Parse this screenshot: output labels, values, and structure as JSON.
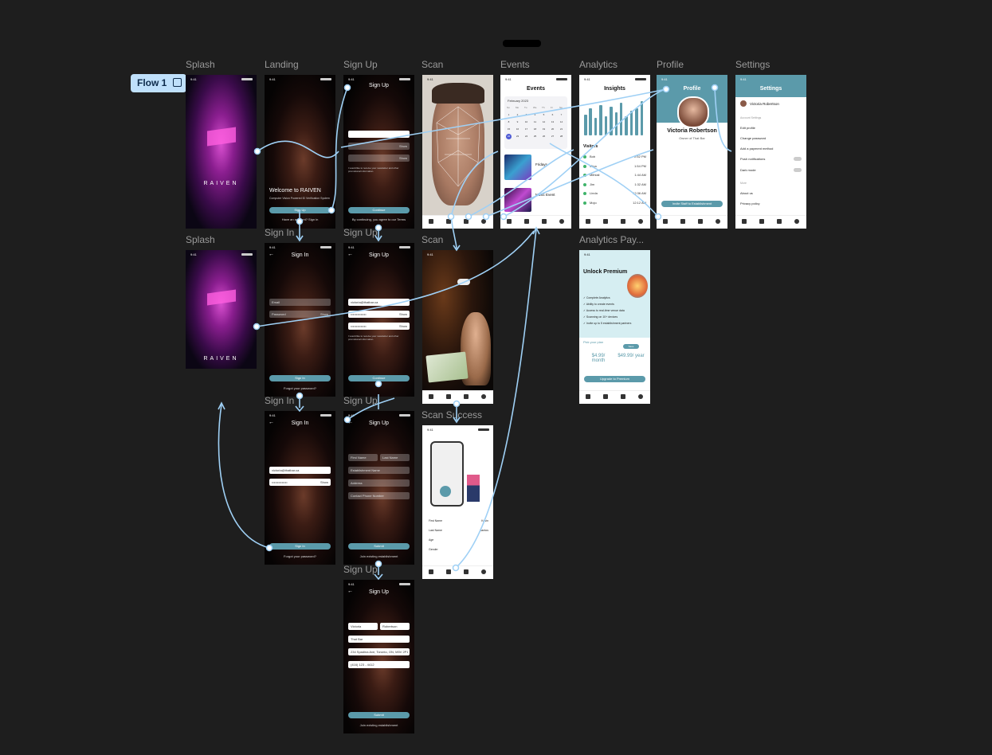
{
  "flow": {
    "label": "Flow 1"
  },
  "labels": {
    "splash1": "Splash",
    "landing": "Landing",
    "signup1": "Sign Up",
    "scan1": "Scan",
    "events": "Events",
    "analytics": "Analytics",
    "profile": "Profile",
    "settings": "Settings",
    "splash2": "Splash",
    "signin1": "Sign In",
    "signup2": "Sign Up",
    "scan2": "Scan",
    "analytics_pay": "Analytics Pay...",
    "signin2": "Sign In",
    "signup3": "Sign Up",
    "scan_success": "Scan Success",
    "signup4": "Sign Up"
  },
  "common": {
    "time": "9:41"
  },
  "splash": {
    "wordmark": "RAIVEN"
  },
  "landing": {
    "welcome": "Welcome to RAIVEN",
    "tagline": "Computer Vision Powered ID Verification System",
    "signup": "Sign Up",
    "have_account": "Have an account? Sign in"
  },
  "signup": {
    "title": "Sign Up",
    "show": "Show",
    "continue": "Continue",
    "submit": "Submit",
    "terms": "I would like to receive your newsletter and other promotional information.",
    "agree": "By continuing, you agree to our Terms",
    "join": "Join existing establishment",
    "email_value": "victoria@thatbar.ca",
    "first_name": "First Name",
    "last_name": "Last Name",
    "establishment": "Establishment Name",
    "address": "Address",
    "phone": "Contact Phone Number",
    "v_first": "Victoria",
    "v_last": "Robertson",
    "v_est": "That Bar",
    "v_address": "234 Spadina Ave, Toronto, ON, M5V 2P1",
    "v_phone": "(416) 123 - 4412"
  },
  "signin": {
    "title": "Sign In",
    "email": "Email",
    "password": "Password",
    "show": "Show",
    "button": "Sign In",
    "forgot": "Forgot your password?",
    "email_value": "victoria@thatbar.ca"
  },
  "events": {
    "title": "Events",
    "month": "February 2023",
    "weekdays": [
      "Su",
      "Mo",
      "Tu",
      "We",
      "Th",
      "Fr",
      "Sa"
    ],
    "ev1": "Fridays",
    "ev2": "Music Event"
  },
  "analytics": {
    "title": "Insights",
    "visitors": "Visitors",
    "rows": [
      {
        "name": "Bob",
        "time": "2:52 PM"
      },
      {
        "name": "Mina",
        "time": "1:54 PM"
      },
      {
        "name": "Mithlali",
        "time": "1:44 AM"
      },
      {
        "name": "Jim",
        "time": "1:32 AM"
      },
      {
        "name": "Linda",
        "time": "12:36 AM"
      },
      {
        "name": "Mojo",
        "time": "12:12 AM"
      }
    ],
    "bars": [
      0.55,
      0.7,
      0.45,
      0.8,
      0.5,
      0.75,
      0.6,
      0.85,
      0.5,
      0.65,
      0.7,
      0.9
    ]
  },
  "profile": {
    "title": "Profile",
    "name": "Victoria Robertson",
    "role": "Owner of That Bar",
    "invite": "Invite Staff to Establishment"
  },
  "settings": {
    "title": "Settings",
    "user": "Victoria Robertson",
    "account_section": "Account Settings",
    "items": [
      "Edit profile",
      "Change password",
      "Add a payment method",
      "Push notifications",
      "Dark mode"
    ],
    "more": "More",
    "about": "About us",
    "privacy": "Privacy policy"
  },
  "premium": {
    "title": "Unlock Premium",
    "features": [
      "Complete Analytics",
      "Ability to create events",
      "Access to real-time venue data",
      "Scanning on 10+ devices",
      "Invite up to 5 establishment partners"
    ],
    "pick": "Pick your plan",
    "badge": "Save",
    "price_month": "$4.99/ month",
    "price_year": "$49.99/ year",
    "upgrade": "Upgrade to Premium"
  },
  "scan_success": {
    "fields": [
      {
        "label": "First Name",
        "value": "Kevin"
      },
      {
        "label": "Last Name",
        "value": "Santos"
      },
      {
        "label": "Age",
        "value": ""
      },
      {
        "label": "Gender",
        "value": ""
      }
    ]
  },
  "colors": {
    "accent": "#5b9aaa",
    "flow_tag": "#bfe0fb",
    "wire": "#9fd0f5",
    "canvas": "#1e1e1e",
    "calendar_today": "#4f5bd5"
  }
}
